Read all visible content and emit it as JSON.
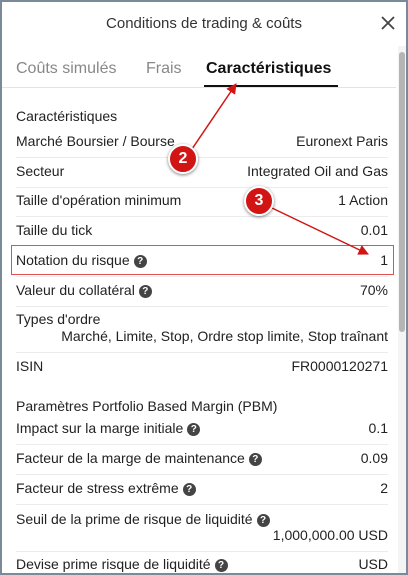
{
  "dialog": {
    "title": "Conditions de trading & coûts",
    "close_icon": "close-icon"
  },
  "tabs": [
    {
      "label": "Coûts simulés",
      "active": false
    },
    {
      "label": "Frais",
      "active": false
    },
    {
      "label": "Caractéristiques",
      "active": true
    }
  ],
  "characteristics": {
    "section_title": "Caractéristiques",
    "market_label": "Marché Boursier / Bourse",
    "market_value": "Euronext Paris",
    "sector_label": "Secteur",
    "sector_value": "Integrated Oil and Gas",
    "min_trade_label": "Taille d'opération minimum",
    "min_trade_value": "1 Action",
    "tick_label": "Taille du tick",
    "tick_value": "0.01",
    "risk_label": "Notation du risque",
    "risk_value": "1",
    "collateral_label": "Valeur du collatéral",
    "collateral_value": "70%",
    "order_types_label": "Types d'ordre",
    "order_types_value": "Marché, Limite, Stop, Ordre stop limite, Stop traînant",
    "isin_label": "ISIN",
    "isin_value": "FR0000120271"
  },
  "pbm": {
    "section_title": "Paramètres Portfolio Based Margin (PBM)",
    "initial_margin_label": "Impact sur la marge initiale",
    "initial_margin_value": "0.1",
    "maintenance_label": "Facteur de la marge de maintenance",
    "maintenance_value": "0.09",
    "stress_label": "Facteur de stress extrême",
    "stress_value": "2",
    "liquidity_threshold_label": "Seuil de la prime de risque de liquidité",
    "liquidity_threshold_value": "1,000,000.00 USD",
    "liquidity_currency_label": "Devise prime risque de liquidité",
    "liquidity_currency_value": "USD"
  },
  "annotations": [
    {
      "label": "2"
    },
    {
      "label": "3"
    }
  ],
  "help_glyph": "?",
  "colors": {
    "annotation_red": "#d11414",
    "highlight_red": "#e25050",
    "active_tab": "#111111",
    "inactive_tab": "#888888"
  }
}
